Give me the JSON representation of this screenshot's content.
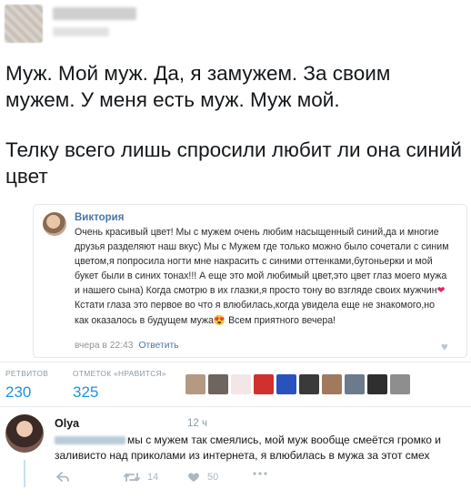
{
  "tweet": {
    "line1": "Муж. Мой муж. Да, я замужем. За своим мужем. У меня есть муж. Муж мой.",
    "line2": "Телку всего лишь спросили любит ли она синий цвет"
  },
  "card": {
    "author": "Виктория",
    "text_a": "Очень красивый цвет! Мы с мужем очень любим насыщенный синий,да и многие друзья разделяют наш вкус) Мы с Мужем где только можно было сочетали с синим цветом,я попросила ногти мне накрасить с синими оттенками,бутоньерки и мой букет были в синих тонах!!! А еще это мой любимый цвет,это цвет глаз моего мужа и нашего сына) Когда смотрю в их глазки,я просто тону во взгляде своих мужчин",
    "heart1": "❤",
    "text_b": " Кстати глаза это первое во что я влюбилась,когда увидела еще не знакомого,но как оказалось в будущем мужа",
    "heart2": "😍",
    "text_c": " Всем приятного вечера!",
    "time": "вчера в 22:43",
    "reply_link": "Ответить",
    "like_icon": "♥"
  },
  "stats": {
    "retweets_label": "РЕТВИТОВ",
    "retweets": "230",
    "likes_label": "ОТМЕТОК «НРАВИТСЯ»",
    "likes": "325"
  },
  "likers": [
    {
      "color": "#b49a82"
    },
    {
      "color": "#6d655e"
    },
    {
      "color": "#f3e6e6"
    },
    {
      "color": "#d0312d"
    },
    {
      "color": "#2a52be"
    },
    {
      "color": "#3a3a3a"
    },
    {
      "color": "#a0795f"
    },
    {
      "color": "#6b7b8c"
    },
    {
      "color": "#2f2f2f"
    },
    {
      "color": "#8e8e8e"
    }
  ],
  "reply": {
    "name": "Olya",
    "time": "12 ч",
    "text": "мы с мужем так смеялись, мой муж вообще смеётся громко и заливисто над приколами из интернета, я влюбилась в мужа за этот смех",
    "retweet_count": "14",
    "like_count": "50"
  }
}
